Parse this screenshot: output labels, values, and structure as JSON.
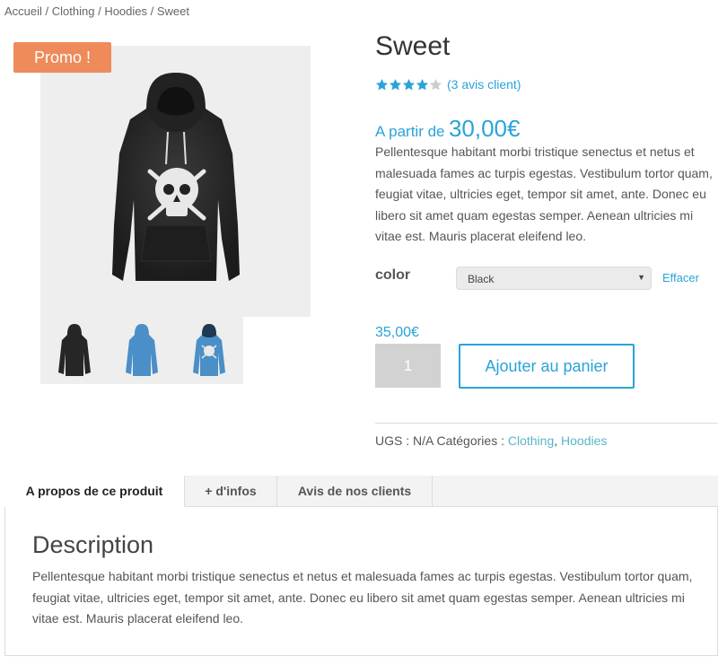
{
  "breadcrumb": {
    "items": [
      "Accueil",
      "Clothing",
      "Hoodies",
      "Sweet"
    ],
    "separator": " / "
  },
  "badge": {
    "promo": "Promo !"
  },
  "gallery": {
    "main_image": "black-hoodie-skull",
    "thumbnails": [
      "black-hoodie",
      "blue-hoodie",
      "blue-hoodie-skull"
    ]
  },
  "product": {
    "title": "Sweet",
    "rating": {
      "stars": 4,
      "max": 5,
      "review_link": "(3 avis client)"
    },
    "price_from_label": "A partir de",
    "price_from_amount": "30,00€",
    "short_description": "Pellentesque habitant morbi tristique senectus et netus et malesuada fames ac turpis egestas. Vestibulum tortor quam, feugiat vitae, ultricies eget, tempor sit amet, ante. Donec eu libero sit amet quam egestas semper. Aenean ultricies mi vitae est. Mauris placerat eleifend leo.",
    "variation": {
      "label": "color",
      "selected": "Black",
      "clear_label": "Effacer"
    },
    "variant_price": "35,00€",
    "quantity": "1",
    "add_to_cart_label": "Ajouter au panier",
    "meta": {
      "sku_label": "UGS :",
      "sku_value": "N/A",
      "categories_label": "Catégories :",
      "categories": [
        "Clothing",
        "Hoodies"
      ],
      "categories_separator": ","
    }
  },
  "tabs": {
    "items": [
      "A propos de ce produit",
      "+ d'infos",
      "Avis de nos clients"
    ],
    "active_index": 0
  },
  "description": {
    "title": "Description",
    "body": "Pellentesque habitant morbi tristique senectus et netus et malesuada fames ac turpis egestas. Vestibulum tortor quam, feugiat vitae, ultricies eget, tempor sit amet, ante. Donec eu libero sit amet quam egestas semper. Aenean ultricies mi vitae est. Mauris placerat eleifend leo."
  },
  "colors": {
    "accent": "#2aa3d8",
    "promo": "#ef8a5a",
    "star": "#2aa3d8",
    "star_empty": "#cccccc",
    "qty_bg": "#d2d2d2"
  }
}
